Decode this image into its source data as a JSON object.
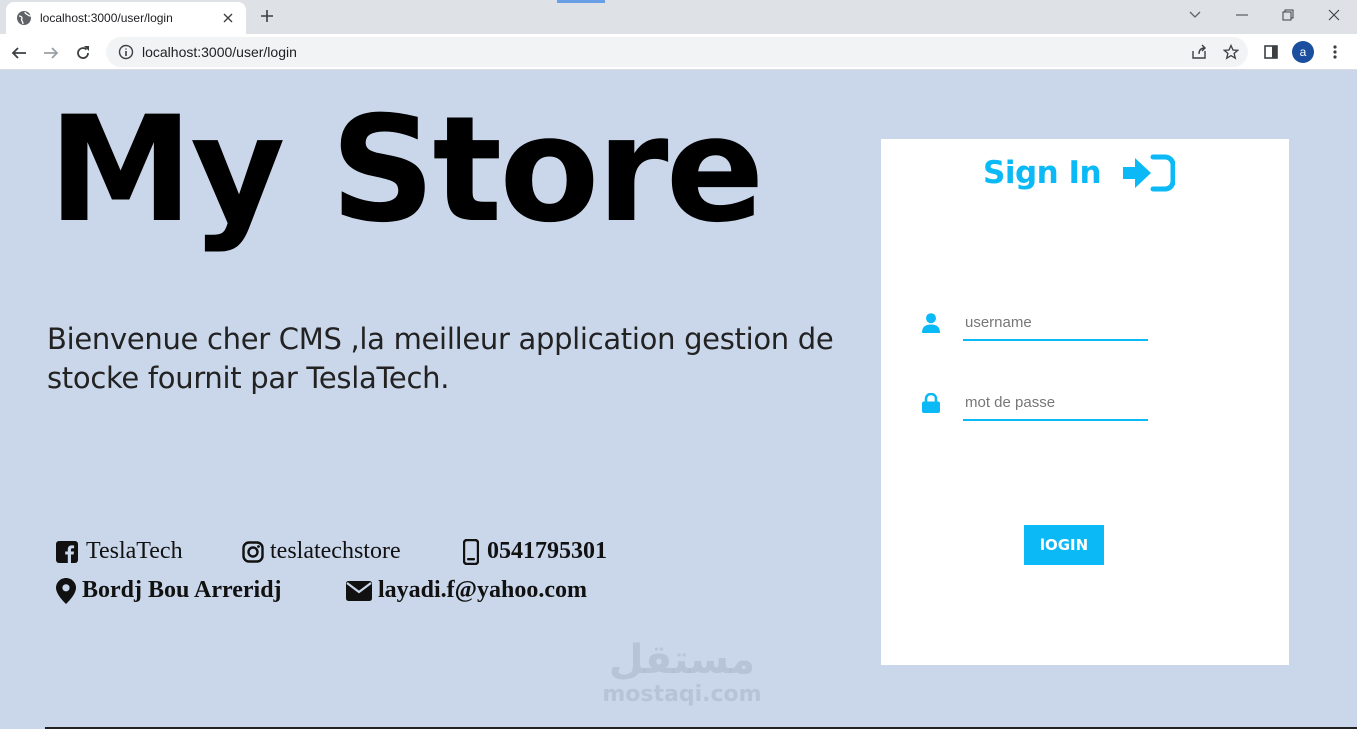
{
  "browser": {
    "tab_title": "localhost:3000/user/login",
    "url": "localhost:3000/user/login",
    "profile_initial": "a"
  },
  "page": {
    "brand": "My Store",
    "welcome": "Bienvenue cher CMS ,la meilleur application gestion de stocke fournit par TeslaTech.",
    "contacts": {
      "facebook": "TeslaTech",
      "instagram": "teslatechstore",
      "phone": "0541795301",
      "location": "Bordj Bou Arreridj",
      "email": "layadi.f@yahoo.com"
    }
  },
  "login": {
    "title": "Sign In",
    "username_placeholder": "username",
    "password_placeholder": "mot de passe",
    "button_label": "lOGIN"
  },
  "watermark": {
    "arabic": "مستقل",
    "latin": "mostaqi.com"
  },
  "colors": {
    "accent": "#0ab9f5",
    "page_background": "#cad7ea",
    "card_background": "#ffffff"
  },
  "icons": [
    "globe-icon",
    "close-icon",
    "plus-icon",
    "back-icon",
    "forward-icon",
    "reload-icon",
    "info-icon",
    "share-icon",
    "star-icon",
    "sidepanel-icon",
    "menu-icon",
    "facebook-icon",
    "instagram-icon",
    "phone-icon",
    "location-icon",
    "envelope-icon",
    "sign-in-icon",
    "user-icon",
    "lock-icon"
  ]
}
